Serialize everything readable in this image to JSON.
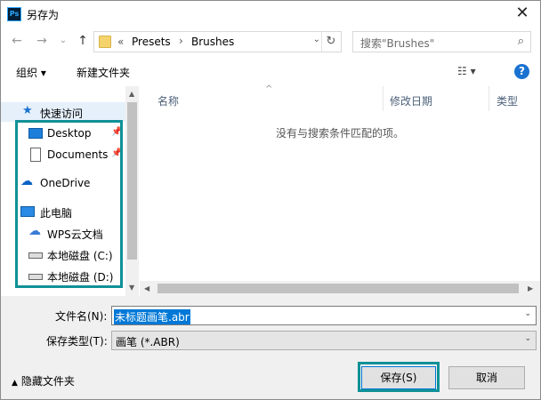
{
  "window": {
    "title": "另存为",
    "app_icon": "Ps",
    "close": "✕"
  },
  "nav": {
    "back": "←",
    "forward": "→",
    "recent": "⌄",
    "up": "↑",
    "breadcrumb_prefix": "«",
    "breadcrumbs": [
      "Presets",
      "Brushes"
    ],
    "crumb_separator": "›",
    "search_placeholder": "搜索\"Brushes\""
  },
  "toolbar": {
    "organize": "组织 ▾",
    "new_folder": "新建文件夹",
    "view": "☷ ▾",
    "help": "?"
  },
  "sidebar": {
    "items": [
      {
        "label": "快速访问",
        "icon": "star-icon"
      },
      {
        "label": "Desktop",
        "icon": "desktop-icon",
        "pinned": true
      },
      {
        "label": "Documents",
        "icon": "document-icon",
        "pinned": true
      },
      {
        "label": "OneDrive",
        "icon": "cloud-icon"
      },
      {
        "label": "此电脑",
        "icon": "computer-icon"
      },
      {
        "label": "WPS云文档",
        "icon": "cloud-outline-icon"
      },
      {
        "label": "本地磁盘 (C:)",
        "icon": "drive-icon"
      },
      {
        "label": "本地磁盘 (D:)",
        "icon": "drive-icon"
      }
    ]
  },
  "filelist": {
    "columns": [
      "名称",
      "修改日期",
      "类型"
    ],
    "empty_message": "没有与搜索条件匹配的项。"
  },
  "form": {
    "filename_label": "文件名(N):",
    "filename_value": "未标题画笔.abr",
    "filetype_label": "保存类型(T):",
    "filetype_value": "画笔 (*.ABR)",
    "hide_folders": "隐藏文件夹",
    "save": "保存(S)",
    "cancel": "取消"
  },
  "colors": {
    "highlight": "#0f9197",
    "selection": "#0078d7",
    "sidebar_selected": "#e5f0fb"
  }
}
